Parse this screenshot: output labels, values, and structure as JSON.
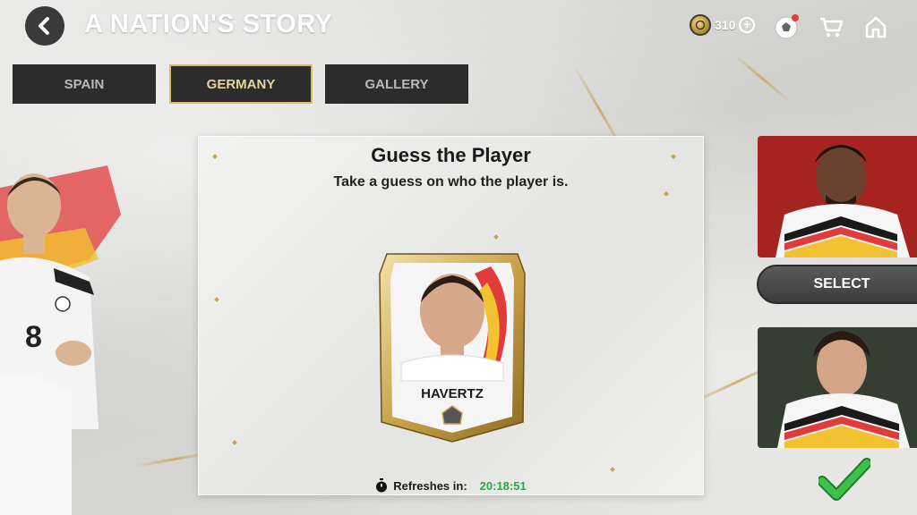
{
  "header": {
    "title": "A NATION'S STORY",
    "coins": "310"
  },
  "tabs": [
    {
      "label": "SPAIN",
      "active": false
    },
    {
      "label": "GERMANY",
      "active": true
    },
    {
      "label": "GALLERY",
      "active": false
    }
  ],
  "panel": {
    "title": "Guess the Player",
    "subtitle": "Take a guess on who the player is.",
    "card_name": "HAVERTZ",
    "refresh_label": "Refreshes in:",
    "refresh_time": "20:18:51"
  },
  "side": {
    "select_label": "SELECT"
  },
  "colors": {
    "accent_gold": "#d8bc6a",
    "timer_green": "#2aa84a",
    "confirm_green": "#3cc24a",
    "notification_red": "#e23b3b"
  },
  "icons": [
    "back-icon",
    "coin-icon",
    "plus-icon",
    "ball-icon",
    "cart-icon",
    "home-icon",
    "stopwatch-icon",
    "checkmark-icon"
  ]
}
